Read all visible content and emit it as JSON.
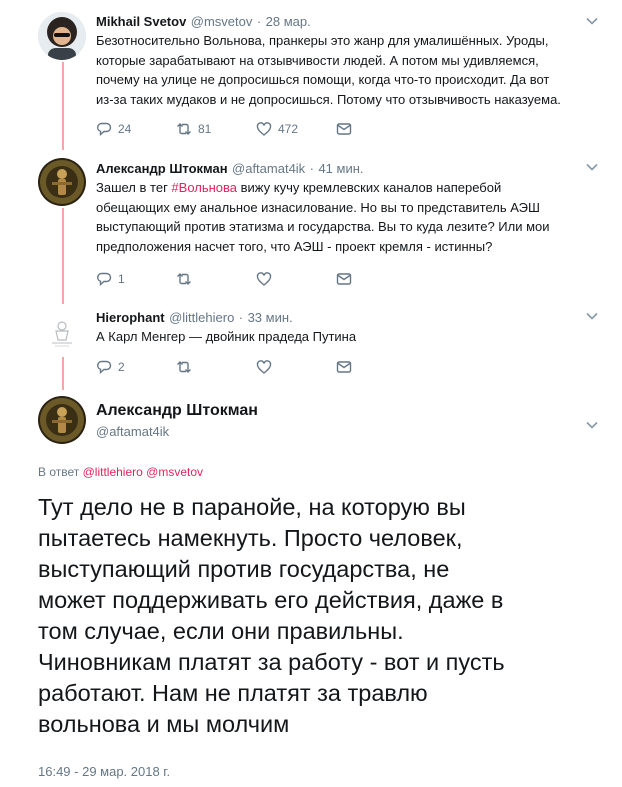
{
  "tweet1": {
    "name": "Mikhail Svetov",
    "handle": "@msvetov",
    "dot": "·",
    "date": "28 мар.",
    "lines": [
      "Безотносительно Вольнова, пранкеры это жанр для умалишённых. Уроды,",
      "которые зарабатывают на отзывчивости людей. А потом мы удивляемся,",
      "почему на улице не допросишься помощи, когда что-то происходит. Да вот",
      "из-за таких мудаков и не допросишься. Потому что отзывчивость наказуема."
    ],
    "replies": "24",
    "retweets": "81",
    "likes": "472"
  },
  "tweet2": {
    "name": "Александр Штокман",
    "handle": "@aftamat4ik",
    "dot": "·",
    "date": "41 мин.",
    "line1_pre": "Зашел в тег ",
    "line1_hashtag": "#Вольнова",
    "line1_post": " вижу кучу кремлевских каналов наперебой",
    "lines": [
      "обещающих ему анальное изнасилование. Но вы то представитель АЭШ",
      "выступающий против этатизма и государства. Вы то куда лезите? Или мои",
      "предположения насчет того, что АЭШ - проект кремля - истинны?"
    ],
    "replies": "1"
  },
  "tweet3": {
    "name": "Hierophant",
    "handle": "@littlehiero",
    "dot": "·",
    "date": "33 мин.",
    "text": "А Карл Менгер — двойник прадеда Путина",
    "replies": "2"
  },
  "main": {
    "name": "Александр Штокман",
    "handle": "@aftamat4ik",
    "reply_prefix": "В ответ",
    "reply_to_1": "@littlehiero",
    "reply_to_2": "@msvetov",
    "lines": [
      "Тут дело не в паранойе, на которую вы",
      "пытаетесь намекнуть. Просто человек,",
      "выступающий против государства, не",
      "может поддерживать  его действия, даже в",
      "том случае, если они правильны.",
      "Чиновникам платят за работу - вот и пусть",
      "работают. Нам не платят за травлю",
      "вольнова и мы молчим"
    ],
    "timestamp": "16:49 - 29 мар. 2018 г."
  },
  "colors": {
    "thread_line": "#f4a6a8",
    "secondary_text": "#657786",
    "hashtag": "#e0245e"
  },
  "icons": [
    "reply-icon",
    "retweet-icon",
    "like-icon",
    "message-icon",
    "chevron-down-icon"
  ]
}
